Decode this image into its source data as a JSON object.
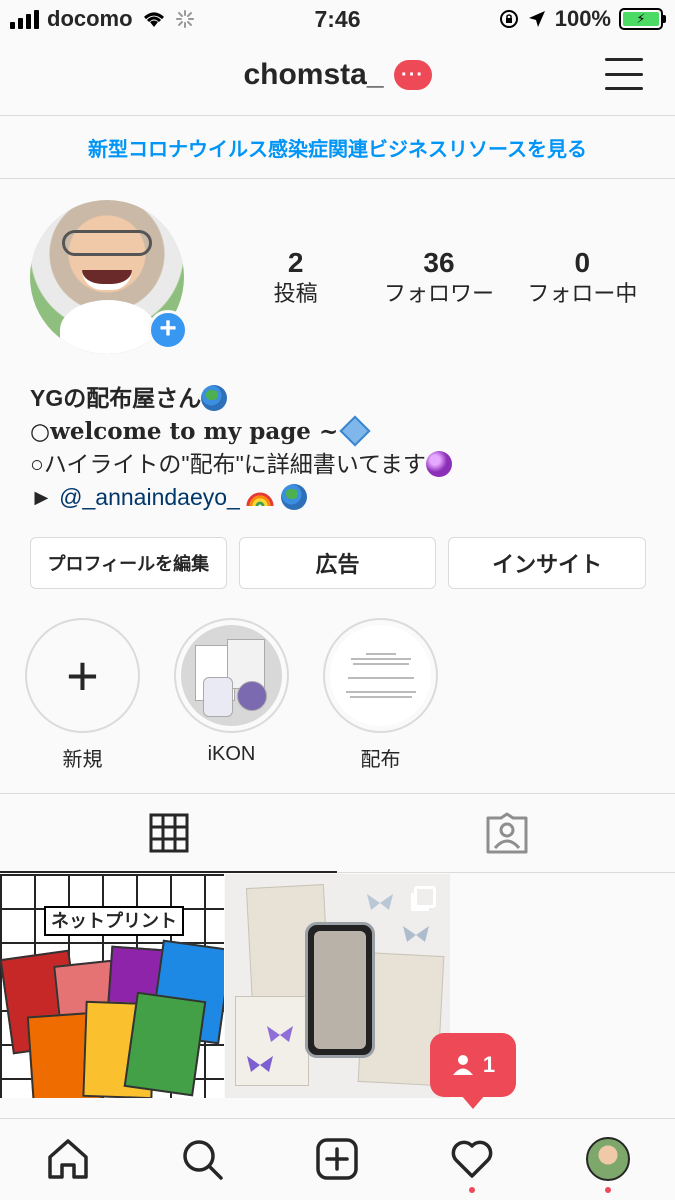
{
  "status_bar": {
    "carrier": "docomo",
    "time": "7:46",
    "battery": "100%"
  },
  "header": {
    "username": "chomsta_",
    "more_badge": "···"
  },
  "banner": {
    "text": "新型コロナウイルス感染症関連ビジネスリソースを見る"
  },
  "stats": [
    {
      "value": "2",
      "label": "投稿"
    },
    {
      "value": "36",
      "label": "フォロワー"
    },
    {
      "value": "0",
      "label": "フォロー中"
    }
  ],
  "bio": {
    "name": "YGの配布屋さん",
    "line1": "○welcome to my page ~",
    "line2": "○ハイライトの\"配布\"に詳細書いてます",
    "line3_prefix": "►",
    "line3_link": "@_annaindaeyo_"
  },
  "buttons": {
    "edit_profile": "プロフィールを編集",
    "ads": "広告",
    "insights": "インサイト"
  },
  "highlights": [
    {
      "label": "新規"
    },
    {
      "label": "iKON"
    },
    {
      "label": "配布"
    }
  ],
  "post1_title": "ネットプリント",
  "notification": {
    "count": "1"
  },
  "colors": {
    "accent_blue": "#0095f6",
    "badge_red": "#ed4956",
    "link_dark_blue": "#00376b",
    "text": "#262626"
  },
  "icons": {
    "grid": "grid-icon",
    "tagged": "tagged-person-icon",
    "home": "home-icon",
    "search": "search-icon",
    "add": "add-post-icon",
    "activity": "heart-icon",
    "profile": "profile-avatar-icon"
  }
}
